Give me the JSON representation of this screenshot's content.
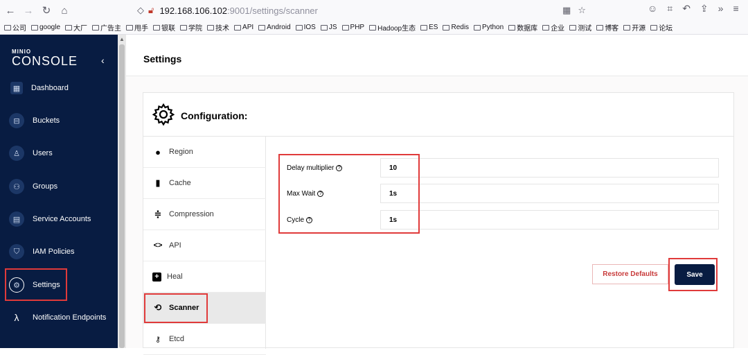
{
  "browser": {
    "url_host": "192.168.106.102",
    "url_rest": ":9001/settings/scanner",
    "bookmarks": [
      "公司",
      "google",
      "大厂",
      "广告主",
      "甩手",
      "银联",
      "学院",
      "技术",
      "API",
      "Android",
      "IOS",
      "JS",
      "PHP",
      "Hadoop生态",
      "ES",
      "Redis",
      "Python",
      "数据库",
      "企业",
      "测试",
      "博客",
      "开源",
      "论坛"
    ]
  },
  "sidebar": {
    "logo_top": "MINIO",
    "logo_main": "CONSOLE",
    "items": [
      {
        "label": "Dashboard",
        "icon": "dashboard-icon"
      },
      {
        "label": "Buckets",
        "icon": "bucket-icon"
      },
      {
        "label": "Users",
        "icon": "user-icon"
      },
      {
        "label": "Groups",
        "icon": "group-icon"
      },
      {
        "label": "Service Accounts",
        "icon": "service-account-icon"
      },
      {
        "label": "IAM Policies",
        "icon": "shield-icon"
      },
      {
        "label": "Settings",
        "icon": "gear-icon"
      },
      {
        "label": "Notification Endpoints",
        "icon": "lambda-icon"
      }
    ]
  },
  "header": {
    "title": "Settings"
  },
  "config": {
    "title": "Configuration:",
    "menu": [
      {
        "label": "Region",
        "icon": "globe-icon"
      },
      {
        "label": "Cache",
        "icon": "sd-card-icon"
      },
      {
        "label": "Compression",
        "icon": "compress-icon"
      },
      {
        "label": "API",
        "icon": "code-icon"
      },
      {
        "label": "Heal",
        "icon": "plus-box-icon"
      },
      {
        "label": "Scanner",
        "icon": "scanner-icon"
      },
      {
        "label": "Etcd",
        "icon": "key-icon"
      }
    ],
    "fields": [
      {
        "label": "Delay multiplier",
        "value": "10"
      },
      {
        "label": "Max Wait",
        "value": "1s"
      },
      {
        "label": "Cycle",
        "value": "1s"
      }
    ],
    "restore_label": "Restore Defaults",
    "save_label": "Save"
  },
  "colors": {
    "sidebar_bg": "#081c42",
    "highlight": "#e03a3a",
    "restore_text": "#c83b3b"
  }
}
